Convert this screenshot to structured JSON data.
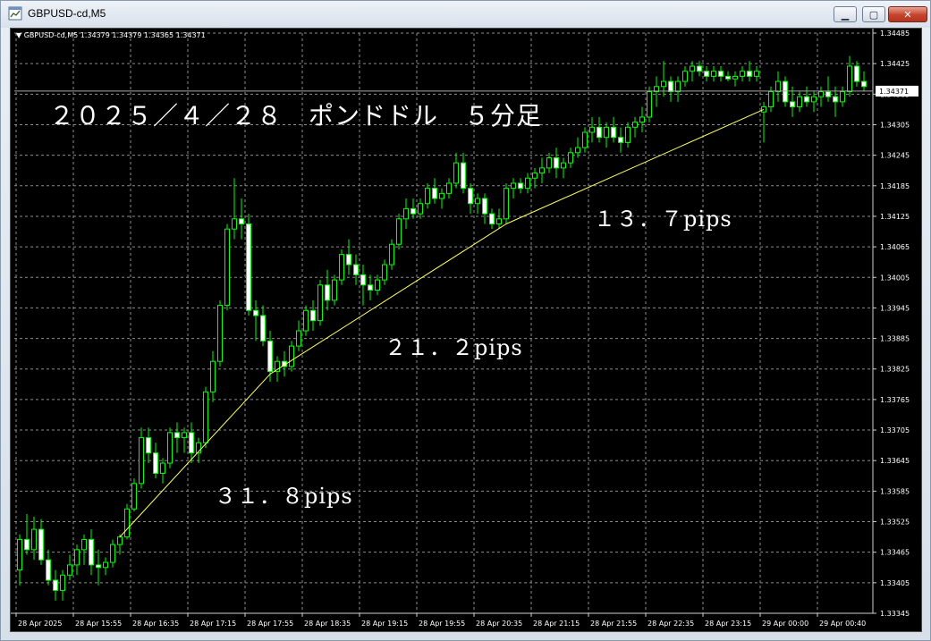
{
  "window": {
    "title": "GBPUSD-cd,M5",
    "minimize_glyph": "▁",
    "maximize_glyph": "▢",
    "close_glyph": "✕"
  },
  "chart_header": {
    "triangle": "▼",
    "text": "GBPUSD-cd,M5  1.34379 1.34379 1.34365 1.34371"
  },
  "annotations": {
    "title": "２０２５／４／２８　ポンドドル　５分足",
    "leg1": "３１．８pips",
    "leg2": "２１．２pips",
    "leg3": "１３．７pips"
  },
  "colors": {
    "background": "#000000",
    "grid": "#8c8c8c",
    "candle": "#00ff00",
    "bull_fill": "#000000",
    "bear_fill": "#ffffff",
    "trendline": "#ffff66",
    "bid_line": "#aaaaaa",
    "price_label_bg": "#ffffff"
  },
  "chart_data": {
    "type": "candlestick",
    "symbol": "GBPUSD-cd",
    "timeframe": "M5",
    "y_ticks": [
      1.34485,
      1.34425,
      1.34365,
      1.34305,
      1.34245,
      1.34185,
      1.34125,
      1.34065,
      1.34005,
      1.33945,
      1.33885,
      1.33825,
      1.33765,
      1.33705,
      1.33645,
      1.33585,
      1.33525,
      1.33465,
      1.33405,
      1.33345
    ],
    "ylim": [
      1.33345,
      1.34485
    ],
    "x_labels": [
      "28 Apr 2025",
      "28 Apr 15:55",
      "28 Apr 16:35",
      "28 Apr 17:15",
      "28 Apr 17:55",
      "28 Apr 18:35",
      "28 Apr 19:15",
      "28 Apr 19:55",
      "28 Apr 20:35",
      "28 Apr 21:15",
      "28 Apr 21:55",
      "28 Apr 22:35",
      "28 Apr 23:15",
      "29 Apr 00:00",
      "29 Apr 00:40"
    ],
    "bars_per_label": 8,
    "current_price": 1.34371,
    "grid": true,
    "trendlines": [
      {
        "from_bar": 14,
        "from_price": 1.33495,
        "to_bar": 35,
        "to_price": 1.33815
      },
      {
        "from_bar": 35,
        "from_price": 1.33815,
        "to_bar": 68,
        "to_price": 1.3411
      },
      {
        "from_bar": 68,
        "from_price": 1.3411,
        "to_bar": 104,
        "to_price": 1.34335
      }
    ],
    "candles": [
      [
        1.3343,
        1.335,
        1.334,
        1.3349
      ],
      [
        1.3349,
        1.3354,
        1.3346,
        1.3347
      ],
      [
        1.3347,
        1.33535,
        1.3345,
        1.3351
      ],
      [
        1.3351,
        1.3353,
        1.3344,
        1.3345
      ],
      [
        1.3345,
        1.3347,
        1.334,
        1.3341
      ],
      [
        1.3341,
        1.3343,
        1.3337,
        1.3339
      ],
      [
        1.3339,
        1.3343,
        1.3337,
        1.3342
      ],
      [
        1.3342,
        1.3346,
        1.3341,
        1.3344
      ],
      [
        1.3344,
        1.3348,
        1.3342,
        1.3347
      ],
      [
        1.3347,
        1.335,
        1.3344,
        1.3349
      ],
      [
        1.3349,
        1.3351,
        1.3342,
        1.3344
      ],
      [
        1.3344,
        1.3347,
        1.334,
        1.33435
      ],
      [
        1.33435,
        1.33455,
        1.3342,
        1.33445
      ],
      [
        1.33445,
        1.3349,
        1.33435,
        1.3348
      ],
      [
        1.3348,
        1.335,
        1.3346,
        1.33495
      ],
      [
        1.33495,
        1.3356,
        1.3349,
        1.3355
      ],
      [
        1.3355,
        1.3361,
        1.33545,
        1.336
      ],
      [
        1.336,
        1.3371,
        1.3359,
        1.3369
      ],
      [
        1.3369,
        1.3371,
        1.3364,
        1.3366
      ],
      [
        1.3366,
        1.3368,
        1.3361,
        1.3362
      ],
      [
        1.3362,
        1.3365,
        1.336,
        1.3364
      ],
      [
        1.3364,
        1.3371,
        1.3363,
        1.337
      ],
      [
        1.337,
        1.3372,
        1.3366,
        1.3369
      ],
      [
        1.3369,
        1.3371,
        1.3366,
        1.337
      ],
      [
        1.337,
        1.3372,
        1.3364,
        1.3366
      ],
      [
        1.3366,
        1.3369,
        1.3364,
        1.3368
      ],
      [
        1.3368,
        1.3379,
        1.3367,
        1.3378
      ],
      [
        1.3378,
        1.3386,
        1.3376,
        1.3384
      ],
      [
        1.3384,
        1.3396,
        1.3383,
        1.3395
      ],
      [
        1.3395,
        1.3411,
        1.3394,
        1.341
      ],
      [
        1.341,
        1.342,
        1.3408,
        1.3412
      ],
      [
        1.3412,
        1.3416,
        1.3408,
        1.3411
      ],
      [
        1.3411,
        1.3413,
        1.3393,
        1.3394
      ],
      [
        1.3394,
        1.3396,
        1.3388,
        1.3393
      ],
      [
        1.3393,
        1.3395,
        1.3387,
        1.3388
      ],
      [
        1.3388,
        1.339,
        1.338,
        1.3382
      ],
      [
        1.3382,
        1.3385,
        1.338,
        1.3384
      ],
      [
        1.3384,
        1.3386,
        1.3381,
        1.3383
      ],
      [
        1.3383,
        1.3388,
        1.3382,
        1.3387
      ],
      [
        1.3387,
        1.3392,
        1.3386,
        1.339
      ],
      [
        1.339,
        1.3395,
        1.3389,
        1.3394
      ],
      [
        1.3394,
        1.3396,
        1.339,
        1.3392
      ],
      [
        1.3392,
        1.34,
        1.3391,
        1.3399
      ],
      [
        1.3399,
        1.3402,
        1.3394,
        1.3396
      ],
      [
        1.3396,
        1.3401,
        1.3395,
        1.34
      ],
      [
        1.34,
        1.3406,
        1.3399,
        1.3405
      ],
      [
        1.3405,
        1.3408,
        1.3401,
        1.3403
      ],
      [
        1.3403,
        1.3405,
        1.3399,
        1.3401
      ],
      [
        1.3401,
        1.3403,
        1.3395,
        1.3399
      ],
      [
        1.3399,
        1.3401,
        1.3396,
        1.3398
      ],
      [
        1.3398,
        1.3401,
        1.3397,
        1.34
      ],
      [
        1.34,
        1.3404,
        1.3399,
        1.3403
      ],
      [
        1.3403,
        1.3408,
        1.3402,
        1.3407
      ],
      [
        1.3407,
        1.3413,
        1.3406,
        1.3412
      ],
      [
        1.3412,
        1.3416,
        1.341,
        1.3414
      ],
      [
        1.3414,
        1.3416,
        1.3412,
        1.3413
      ],
      [
        1.3413,
        1.3416,
        1.3412,
        1.3415
      ],
      [
        1.3415,
        1.3419,
        1.3414,
        1.3418
      ],
      [
        1.3418,
        1.342,
        1.3415,
        1.3416
      ],
      [
        1.3416,
        1.3418,
        1.3414,
        1.3417
      ],
      [
        1.3417,
        1.342,
        1.3416,
        1.3419
      ],
      [
        1.3419,
        1.3425,
        1.3418,
        1.3423
      ],
      [
        1.3423,
        1.3425,
        1.3417,
        1.3418
      ],
      [
        1.3418,
        1.3419,
        1.3413,
        1.3415
      ],
      [
        1.3415,
        1.3417,
        1.3413,
        1.3416
      ],
      [
        1.3416,
        1.3417,
        1.3411,
        1.3413
      ],
      [
        1.3413,
        1.3414,
        1.341,
        1.3411
      ],
      [
        1.3411,
        1.3414,
        1.341,
        1.3412
      ],
      [
        1.3412,
        1.3419,
        1.3411,
        1.3418
      ],
      [
        1.3418,
        1.342,
        1.3416,
        1.3419
      ],
      [
        1.3419,
        1.342,
        1.3417,
        1.3418
      ],
      [
        1.3418,
        1.3421,
        1.3417,
        1.342
      ],
      [
        1.342,
        1.3422,
        1.3418,
        1.3421
      ],
      [
        1.3421,
        1.3424,
        1.3419,
        1.3422
      ],
      [
        1.3422,
        1.3425,
        1.3421,
        1.3424
      ],
      [
        1.3424,
        1.3426,
        1.342,
        1.3422
      ],
      [
        1.3422,
        1.3424,
        1.342,
        1.3423
      ],
      [
        1.3423,
        1.3426,
        1.3422,
        1.3425
      ],
      [
        1.3425,
        1.3428,
        1.3424,
        1.3426
      ],
      [
        1.3426,
        1.343,
        1.3425,
        1.3429
      ],
      [
        1.3429,
        1.3432,
        1.3427,
        1.343
      ],
      [
        1.343,
        1.3432,
        1.3427,
        1.3428
      ],
      [
        1.3428,
        1.3431,
        1.3426,
        1.343
      ],
      [
        1.343,
        1.3432,
        1.3427,
        1.3428
      ],
      [
        1.3428,
        1.343,
        1.3425,
        1.3427
      ],
      [
        1.3427,
        1.3431,
        1.3426,
        1.343
      ],
      [
        1.343,
        1.3432,
        1.3428,
        1.3431
      ],
      [
        1.3431,
        1.3434,
        1.3429,
        1.3432
      ],
      [
        1.3432,
        1.3438,
        1.3431,
        1.3437
      ],
      [
        1.3437,
        1.344,
        1.3434,
        1.3438
      ],
      [
        1.3438,
        1.3443,
        1.3436,
        1.3439
      ],
      [
        1.3439,
        1.344,
        1.3435,
        1.3437
      ],
      [
        1.3437,
        1.344,
        1.3435,
        1.3439
      ],
      [
        1.3439,
        1.3442,
        1.3438,
        1.3441
      ],
      [
        1.3441,
        1.3443,
        1.3439,
        1.3442
      ],
      [
        1.3442,
        1.3443,
        1.344,
        1.3441
      ],
      [
        1.3441,
        1.3442,
        1.3439,
        1.344
      ],
      [
        1.344,
        1.3442,
        1.3439,
        1.3441
      ],
      [
        1.3441,
        1.3442,
        1.3439,
        1.344
      ],
      [
        1.344,
        1.3441,
        1.3439,
        1.34395
      ],
      [
        1.34395,
        1.3441,
        1.3438,
        1.344
      ],
      [
        1.344,
        1.3442,
        1.3439,
        1.3441
      ],
      [
        1.3441,
        1.3443,
        1.3439,
        1.344
      ],
      [
        1.344,
        1.3442,
        1.3439,
        1.3441
      ],
      [
        1.3433,
        1.3435,
        1.3427,
        1.3434
      ],
      [
        1.3434,
        1.3438,
        1.3433,
        1.3437
      ],
      [
        1.3437,
        1.3441,
        1.3435,
        1.3439
      ],
      [
        1.3439,
        1.344,
        1.3434,
        1.3435
      ],
      [
        1.3435,
        1.3438,
        1.3432,
        1.3434
      ],
      [
        1.3434,
        1.3437,
        1.3433,
        1.3436
      ],
      [
        1.3436,
        1.3438,
        1.3434,
        1.3435
      ],
      [
        1.3435,
        1.3437,
        1.3433,
        1.3436
      ],
      [
        1.3436,
        1.3438,
        1.3434,
        1.3437
      ],
      [
        1.3437,
        1.344,
        1.3435,
        1.3436
      ],
      [
        1.3436,
        1.3438,
        1.3432,
        1.3435
      ],
      [
        1.3435,
        1.3438,
        1.3434,
        1.3437
      ],
      [
        1.3437,
        1.3444,
        1.3436,
        1.3442
      ],
      [
        1.3442,
        1.3443,
        1.3438,
        1.3439
      ],
      [
        1.3439,
        1.3441,
        1.3437,
        1.3438
      ],
      [
        1.3438,
        1.3439,
        1.3436,
        1.34371
      ]
    ]
  }
}
